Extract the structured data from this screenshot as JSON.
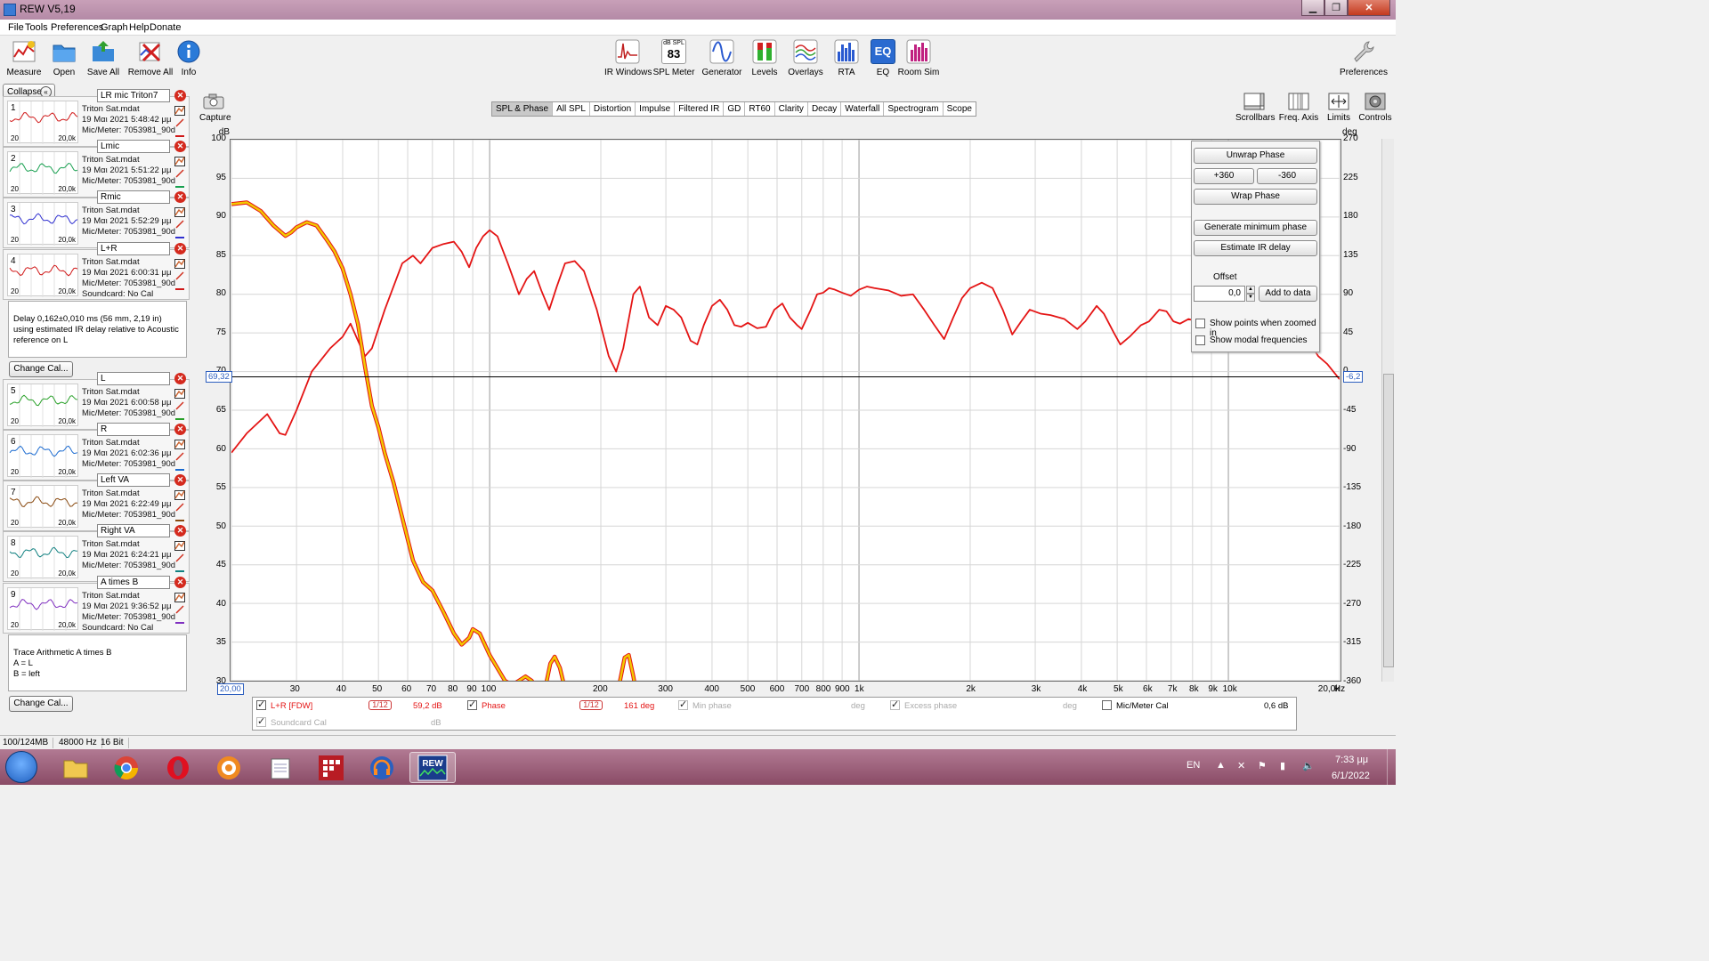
{
  "window": {
    "title": "REW V5,19"
  },
  "menu": [
    "File",
    "Tools",
    "Preferences",
    "Graph",
    "Help",
    "Donate"
  ],
  "toolbar_left": [
    {
      "label": "Measure",
      "icon": "measure-icon"
    },
    {
      "label": "Open",
      "icon": "folder-icon"
    },
    {
      "label": "Save All",
      "icon": "save-icon"
    },
    {
      "label": "Remove All",
      "icon": "remove-all-icon"
    },
    {
      "label": "Info",
      "icon": "info-icon"
    }
  ],
  "toolbar_center": [
    {
      "label": "IR Windows",
      "icon": "ir-windows-icon"
    },
    {
      "label": "SPL Meter",
      "icon": "spl-meter-icon",
      "badge_top": "dB SPL",
      "badge_value": "83"
    },
    {
      "label": "Generator",
      "icon": "generator-icon"
    },
    {
      "label": "Levels",
      "icon": "levels-icon"
    },
    {
      "label": "Overlays",
      "icon": "overlays-icon"
    },
    {
      "label": "RTA",
      "icon": "rta-icon"
    },
    {
      "label": "EQ",
      "icon": "eq-icon"
    },
    {
      "label": "Room Sim",
      "icon": "room-sim-icon"
    }
  ],
  "toolbar_right": {
    "label": "Preferences",
    "icon": "wrench-icon"
  },
  "left_panel": {
    "collapse_label": "Collapse",
    "thumb_start": "20",
    "thumb_end": "20,0k",
    "measurements": [
      {
        "num": "1",
        "name": "LR mic Triton7",
        "file": "Triton Sat.mdat",
        "date": "19 Μαι 2021 5:48:42 μμ",
        "mic": "Mic/Meter: 7053981_90d",
        "color": "#d01818"
      },
      {
        "num": "2",
        "name": "Lmic",
        "file": "Triton Sat.mdat",
        "date": "19 Μαι 2021 5:51:22 μμ",
        "mic": "Mic/Meter: 7053981_90d",
        "color": "#18a050"
      },
      {
        "num": "3",
        "name": "Rmic",
        "file": "Triton Sat.mdat",
        "date": "19 Μαι 2021 5:52:29 μμ",
        "mic": "Mic/Meter: 7053981_90d",
        "color": "#3030d0"
      },
      {
        "num": "4",
        "name": "L+R",
        "file": "Triton Sat.mdat",
        "date": "19 Μαι 2021 6:00:31 μμ",
        "mic": "Mic/Meter: 7053981_90d",
        "soundcard": "Soundcard: No Cal",
        "color": "#d01818"
      },
      {
        "num": "5",
        "name": "L",
        "file": "Triton Sat.mdat",
        "date": "19 Μαι 2021 6:00:58 μμ",
        "mic": "Mic/Meter: 7053981_90d",
        "color": "#28a028"
      },
      {
        "num": "6",
        "name": "R",
        "file": "Triton Sat.mdat",
        "date": "19 Μαι 2021 6:02:36 μμ",
        "mic": "Mic/Meter: 7053981_90d",
        "color": "#1a6ad0"
      },
      {
        "num": "7",
        "name": "Left VA",
        "file": "Triton Sat.mdat",
        "date": "19 Μαι 2021 6:22:49 μμ",
        "mic": "Mic/Meter: 7053981_90d",
        "color": "#8a4a10"
      },
      {
        "num": "8",
        "name": "Right VA",
        "file": "Triton Sat.mdat",
        "date": "19 Μαι 2021 6:24:21 μμ",
        "mic": "Mic/Meter: 7053981_90d",
        "color": "#108080"
      },
      {
        "num": "9",
        "name": "A times B",
        "file": "Triton Sat.mdat",
        "date": "19 Μαι 2021 9:36:52 μμ",
        "mic": "Mic/Meter: 7053981_90d",
        "soundcard": "Soundcard: No Cal",
        "color": "#8030c0"
      }
    ],
    "info4": [
      "Delay 0,162±0,010 ms (56 mm, 2,19 in)",
      "using estimated IR delay relative to Acoustic",
      "reference on  L"
    ],
    "info9": [
      "Trace Arithmetic A times B",
      "A = L",
      "B = left"
    ],
    "change_cal_label": "Change Cal..."
  },
  "graph": {
    "capture_label": "Capture",
    "tabs": [
      "SPL & Phase",
      "All SPL",
      "Distortion",
      "Impulse",
      "Filtered IR",
      "GD",
      "RT60",
      "Clarity",
      "Decay",
      "Waterfall",
      "Spectrogram",
      "Scope"
    ],
    "active_tab": "SPL & Phase",
    "right_tools": [
      {
        "label": "Scrollbars",
        "icon": "scrollbars-icon"
      },
      {
        "label": "Freq. Axis",
        "icon": "freq-axis-icon"
      },
      {
        "label": "Limits",
        "icon": "limits-icon"
      },
      {
        "label": "Controls",
        "icon": "controls-icon"
      }
    ],
    "y_unit_left": "dB",
    "y_unit_right": "deg",
    "x_unit": "Hz",
    "cursor_left": "69,32",
    "cursor_right": "-6,2",
    "cursor_x": "20,00"
  },
  "chart_data": {
    "type": "line",
    "x_scale": "log",
    "xlim": [
      20,
      20000
    ],
    "ylim": [
      30,
      100
    ],
    "y2lim": [
      -360,
      270
    ],
    "y_ticks": [
      "100",
      "95",
      "90",
      "85",
      "80",
      "75",
      "70",
      "65",
      "60",
      "55",
      "50",
      "45",
      "40",
      "35",
      "30"
    ],
    "y2_ticks": [
      "270",
      "225",
      "180",
      "135",
      "90",
      "45",
      "0",
      "-45",
      "-90",
      "-135",
      "-180",
      "-225",
      "-270",
      "-315",
      "-360"
    ],
    "x_ticks": [
      {
        "v": 30,
        "t": "30"
      },
      {
        "v": 40,
        "t": "40"
      },
      {
        "v": 50,
        "t": "50"
      },
      {
        "v": 60,
        "t": "60"
      },
      {
        "v": 70,
        "t": "70"
      },
      {
        "v": 80,
        "t": "80"
      },
      {
        "v": 90,
        "t": "90"
      },
      {
        "v": 100,
        "t": "100"
      },
      {
        "v": 200,
        "t": "200"
      },
      {
        "v": 300,
        "t": "300"
      },
      {
        "v": 400,
        "t": "400"
      },
      {
        "v": 500,
        "t": "500"
      },
      {
        "v": 600,
        "t": "600"
      },
      {
        "v": 700,
        "t": "700"
      },
      {
        "v": 800,
        "t": "800"
      },
      {
        "v": 900,
        "t": "900"
      },
      {
        "v": 1000,
        "t": "1k"
      },
      {
        "v": 2000,
        "t": "2k"
      },
      {
        "v": 3000,
        "t": "3k"
      },
      {
        "v": 4000,
        "t": "4k"
      },
      {
        "v": 5000,
        "t": "5k"
      },
      {
        "v": 6000,
        "t": "6k"
      },
      {
        "v": 7000,
        "t": "7k"
      },
      {
        "v": 8000,
        "t": "8k"
      },
      {
        "v": 9000,
        "t": "9k"
      },
      {
        "v": 10000,
        "t": "10k"
      },
      {
        "v": 20000,
        "t": "20,0k"
      }
    ],
    "cursor_y": 69.32,
    "series": [
      {
        "name": "L+R [FDW]",
        "color": "#e41414",
        "axis": "left",
        "points": [
          [
            20,
            59.5
          ],
          [
            22,
            62
          ],
          [
            25,
            64.5
          ],
          [
            27,
            62
          ],
          [
            28,
            61.8
          ],
          [
            30,
            65
          ],
          [
            33,
            70
          ],
          [
            37,
            73
          ],
          [
            40,
            74.5
          ],
          [
            42,
            76.2
          ],
          [
            44,
            74
          ],
          [
            46,
            72
          ],
          [
            48,
            73
          ],
          [
            52,
            78
          ],
          [
            58,
            84
          ],
          [
            62,
            85
          ],
          [
            65,
            84
          ],
          [
            70,
            86
          ],
          [
            75,
            86.5
          ],
          [
            80,
            86.8
          ],
          [
            84,
            85.5
          ],
          [
            88,
            83.5
          ],
          [
            92,
            86
          ],
          [
            96,
            87.5
          ],
          [
            100,
            88.3
          ],
          [
            105,
            87.5
          ],
          [
            112,
            84
          ],
          [
            120,
            80
          ],
          [
            126,
            82
          ],
          [
            132,
            83
          ],
          [
            138,
            80.5
          ],
          [
            145,
            78
          ],
          [
            152,
            81
          ],
          [
            160,
            84
          ],
          [
            170,
            84.3
          ],
          [
            180,
            83
          ],
          [
            195,
            78
          ],
          [
            210,
            72
          ],
          [
            220,
            70
          ],
          [
            230,
            73
          ],
          [
            245,
            80
          ],
          [
            255,
            81
          ],
          [
            270,
            77
          ],
          [
            285,
            76
          ],
          [
            300,
            78.5
          ],
          [
            315,
            78
          ],
          [
            330,
            77
          ],
          [
            350,
            74
          ],
          [
            365,
            73.5
          ],
          [
            380,
            76
          ],
          [
            400,
            78.5
          ],
          [
            420,
            79.3
          ],
          [
            440,
            78
          ],
          [
            460,
            76
          ],
          [
            480,
            75.8
          ],
          [
            500,
            76.3
          ],
          [
            530,
            75.6
          ],
          [
            560,
            75.8
          ],
          [
            590,
            78
          ],
          [
            620,
            78.8
          ],
          [
            650,
            77
          ],
          [
            680,
            76
          ],
          [
            700,
            75.5
          ],
          [
            740,
            78
          ],
          [
            770,
            80
          ],
          [
            800,
            80.2
          ],
          [
            830,
            80.8
          ],
          [
            860,
            80.6
          ],
          [
            900,
            80.2
          ],
          [
            950,
            79.8
          ],
          [
            1000,
            80.6
          ],
          [
            1050,
            81
          ],
          [
            1100,
            80.8
          ],
          [
            1200,
            80.5
          ],
          [
            1300,
            79.8
          ],
          [
            1400,
            80
          ],
          [
            1500,
            78
          ],
          [
            1600,
            76
          ],
          [
            1700,
            74.2
          ],
          [
            1800,
            77
          ],
          [
            1900,
            79.5
          ],
          [
            2000,
            80.8
          ],
          [
            2150,
            81.5
          ],
          [
            2300,
            80.8
          ],
          [
            2450,
            78
          ],
          [
            2600,
            74.8
          ],
          [
            2750,
            76.5
          ],
          [
            2900,
            78
          ],
          [
            3100,
            77.5
          ],
          [
            3300,
            77.3
          ],
          [
            3600,
            76.8
          ],
          [
            3900,
            75.5
          ],
          [
            4100,
            76.5
          ],
          [
            4400,
            78.5
          ],
          [
            4600,
            77.5
          ],
          [
            4900,
            75
          ],
          [
            5100,
            73.5
          ],
          [
            5400,
            74.5
          ],
          [
            5800,
            76
          ],
          [
            6100,
            76.5
          ],
          [
            6500,
            78
          ],
          [
            6800,
            77.8
          ],
          [
            7100,
            76.5
          ],
          [
            7400,
            76.2
          ],
          [
            7800,
            76.8
          ],
          [
            8200,
            76.5
          ],
          [
            8700,
            76.5
          ],
          [
            9200,
            77
          ],
          [
            9800,
            77.5
          ],
          [
            10500,
            77
          ],
          [
            11500,
            77.5
          ],
          [
            12500,
            78
          ],
          [
            13500,
            77.5
          ],
          [
            14500,
            77.5
          ],
          [
            15500,
            76.5
          ],
          [
            16500,
            74
          ],
          [
            17500,
            72
          ],
          [
            18500,
            71
          ],
          [
            20000,
            69
          ]
        ]
      },
      {
        "name": "Phase",
        "color": "#f2c800",
        "outline": "#e41414",
        "axis": "right",
        "points": [
          [
            20,
            195
          ],
          [
            22,
            197
          ],
          [
            24,
            187
          ],
          [
            26,
            170
          ],
          [
            28,
            158
          ],
          [
            29,
            162
          ],
          [
            30,
            168
          ],
          [
            32,
            174
          ],
          [
            34,
            170
          ],
          [
            36,
            155
          ],
          [
            38,
            140
          ],
          [
            40,
            120
          ],
          [
            42,
            90
          ],
          [
            44,
            55
          ],
          [
            46,
            5
          ],
          [
            48,
            -40
          ],
          [
            50,
            -65
          ],
          [
            52,
            -95
          ],
          [
            55,
            -130
          ],
          [
            58,
            -170
          ],
          [
            62,
            -220
          ],
          [
            66,
            -245
          ],
          [
            70,
            -255
          ],
          [
            75,
            -280
          ],
          [
            80,
            -305
          ],
          [
            84,
            -318
          ],
          [
            88,
            -310
          ],
          [
            90,
            -300
          ],
          [
            94,
            -305
          ],
          [
            100,
            -330
          ],
          [
            110,
            -360
          ],
          [
            115,
            -365
          ],
          [
            120,
            -360
          ],
          [
            125,
            -355
          ],
          [
            130,
            -360
          ],
          [
            135,
            -370
          ],
          [
            142,
            -365
          ],
          [
            146,
            -340
          ],
          [
            150,
            -332
          ],
          [
            155,
            -345
          ],
          [
            160,
            -370
          ],
          [
            170,
            -390
          ],
          [
            190,
            -400
          ],
          [
            215,
            -380
          ],
          [
            225,
            -362
          ],
          [
            232,
            -333
          ],
          [
            238,
            -330
          ],
          [
            245,
            -355
          ],
          [
            252,
            -385
          ],
          [
            270,
            -400
          ],
          [
            300,
            -420
          ]
        ]
      }
    ]
  },
  "controls": {
    "unwrap_label": "Unwrap Phase",
    "plus360_label": "+360",
    "minus360_label": "-360",
    "wrap_label": "Wrap Phase",
    "min_phase_label": "Generate minimum phase",
    "estimate_ir_label": "Estimate IR delay",
    "offset_label": "Offset",
    "offset_value": "0,0",
    "add_to_data_label": "Add to data",
    "show_points_label": "Show points when zoomed in",
    "show_modal_label": "Show modal frequencies"
  },
  "legend": {
    "spl_name": "L+R [FDW]",
    "spl_smoothing": "1/12",
    "spl_value": "59,2 dB",
    "phase_name": "Phase",
    "phase_smoothing": "1/12",
    "phase_value": "161 deg",
    "min_phase_name": "Min phase",
    "min_phase_unit": "deg",
    "excess_phase_name": "Excess phase",
    "excess_phase_unit": "deg",
    "mic_cal_name": "Mic/Meter Cal",
    "mic_cal_value": "0,6 dB",
    "soundcard_cal_name": "Soundcard Cal",
    "soundcard_cal_unit": "dB"
  },
  "status": {
    "memory": "100/124MB",
    "rate": "48000 Hz",
    "bits": "16 Bit"
  },
  "taskbar": {
    "lang": "EN",
    "time": "7:33 μμ",
    "date": "6/1/2022"
  }
}
